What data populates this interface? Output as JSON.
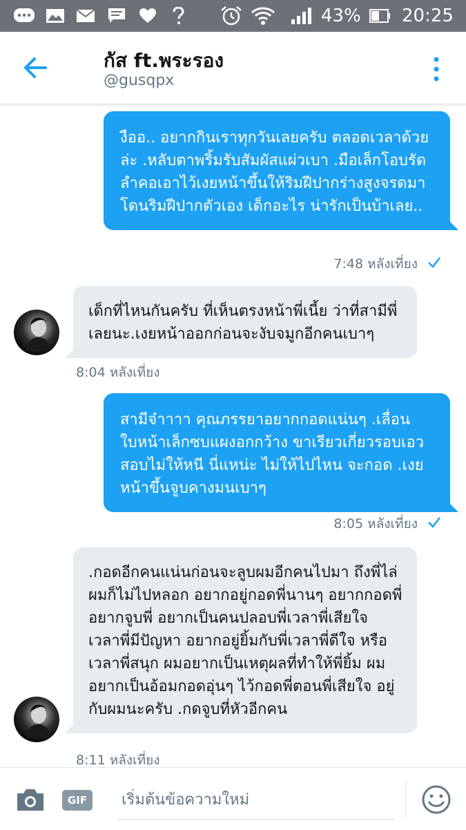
{
  "status_bar": {
    "battery": "43%",
    "time": "20:25"
  },
  "header": {
    "title": "กัส ft.พระรอง",
    "handle": "@gusqpx"
  },
  "messages": [
    {
      "side": "out",
      "text": "งืออ.. อยากกินเราทุกวันเลยครับ ตลอดเวลาด้วยล่ะ .หลับตาพริ้มรับสัมผัสแผ่วเบา .มือเล็กโอบรัดลำคอเอาไว้เงยหน้าขึ้นให้ริมฝีปากร่างสูงจรดมาโดนริมฝีปากตัวเอง เด็กอะไร น่ารักเป็นบ้าเลย..",
      "time": "7:48 หลังเที่ยง"
    },
    {
      "side": "in",
      "text": "เด็กที่ไหนกันครับ ที่เห็นตรงหน้าพี่เนี้ย ว่าที่สามีพี่เลยนะ.เงยหน้าออกก่อนจะงับจมูกอีกคนเบาๆ",
      "time": "8:04 หลังเที่ยง"
    },
    {
      "side": "out",
      "text": "สามีจ๋าาาา คุณภรรยาอยากกอดแน่นๆ .เลื่อนใบหน้าเล็กซบแผงอกกว้าง ขาเรียวเกี่ยวรอบเอวสอบไม่ให้หนี นี่แหน่ะ ไม่ให้ไปไหน จะกอด .เงยหน้าขึ้นจูบคางมนเบาๆ",
      "time": "8:05 หลังเที่ยง"
    },
    {
      "side": "in",
      "text": ".กอดอีกคนแน่นก่อนจะลูบผมอีกคนไปมา ถึงพี่ไล่ผมก็ไม่ไปหลอก อยากอยู่กอดพี่นานๆ อยากกอดพี่ อยากจูบพี่ อยากเป็นคนปลอบพี่เวลาพี่เสียใจ เวลาพี่มีปัญหา อยากอยู่ยิ้มกับพี่เวลาพี่ดีใจ หรือ เวลาพี่สนุก ผมอยากเป็นเหตุผลที่ทำให้พี่ยิ้ม ผมอยากเป็นอ้อมกอดอุ่นๆ ไว้กอดพี่ตอนพี่เสียใจ อยู่กับผมนะครับ .กดจูบที่หัวอีกคน",
      "time": "8:11 หลังเที่ยง"
    }
  ],
  "composer": {
    "gif_label": "GIF",
    "placeholder": "เริ่มต้นข้อความใหม่"
  },
  "colors": {
    "accent": "#1da1f2",
    "incoming_bubble": "#e6ecf0",
    "status_bar": "#6b7177"
  },
  "icons": [
    "chat-bubble-icon",
    "image-icon",
    "mail-icon",
    "message-icon",
    "heart-icon",
    "question-icon",
    "alarm-icon",
    "wifi-icon",
    "signal-icon",
    "battery-icon",
    "back-arrow-icon",
    "more-vertical-icon",
    "avatar",
    "check-icon",
    "camera-icon",
    "emoji-icon"
  ]
}
